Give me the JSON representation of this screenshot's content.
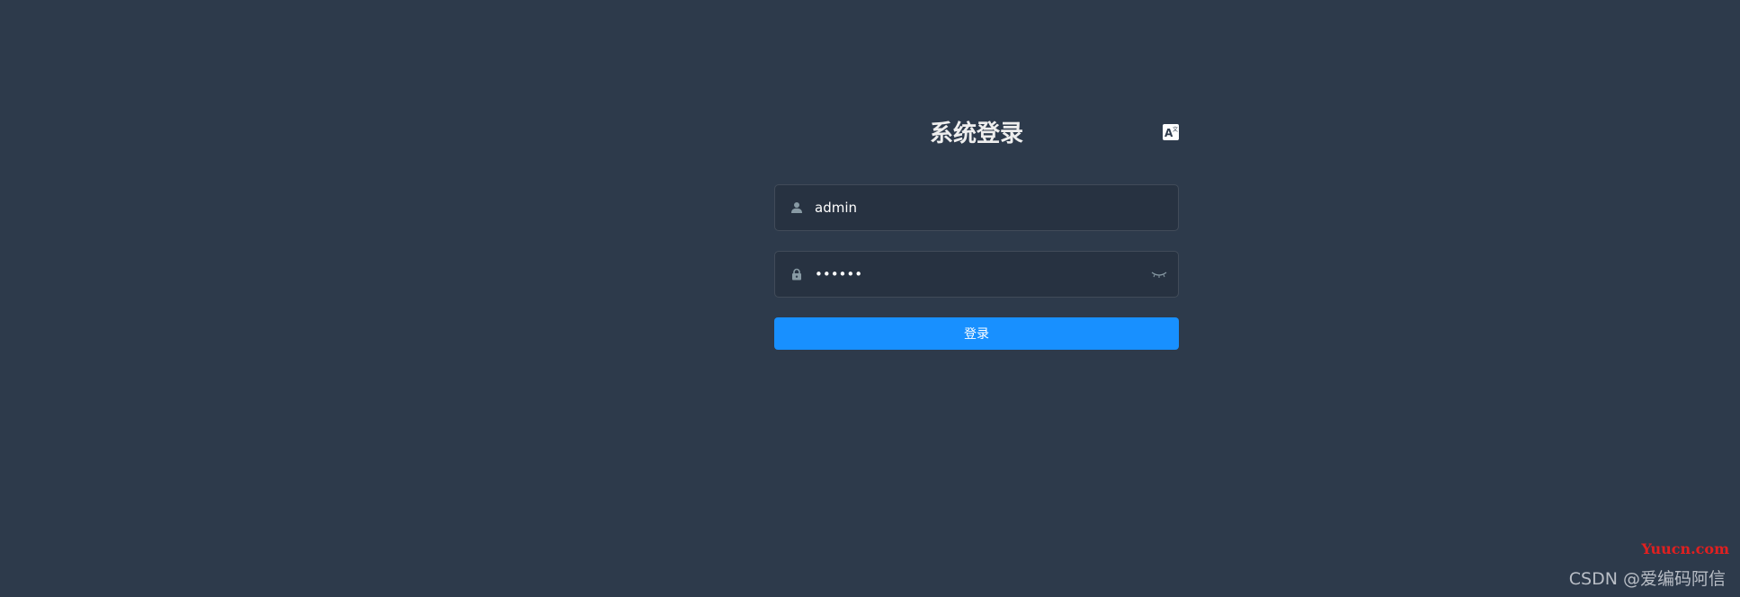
{
  "login": {
    "title": "系统登录",
    "username": {
      "value": "admin",
      "placeholder": ""
    },
    "password": {
      "value": "111111",
      "placeholder": ""
    },
    "submit_label": "登录"
  },
  "icons": {
    "lang_switch": "translate-icon",
    "username": "user-icon",
    "password": "lock-icon",
    "toggle_password": "eye-closed-icon"
  },
  "colors": {
    "background": "#2d3a4b",
    "primary": "#1890ff",
    "title": "#eeeeee"
  },
  "watermark": {
    "site": "Yuucn.com",
    "author": "CSDN @爱编码阿信"
  }
}
